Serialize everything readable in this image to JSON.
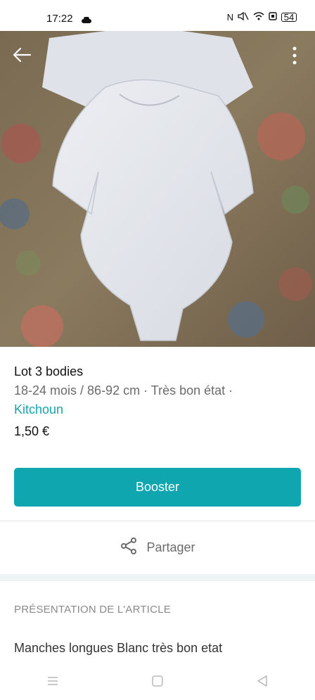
{
  "status_bar": {
    "time": "17:22",
    "battery": "54",
    "icons": [
      "cloud-icon",
      "nfc-icon",
      "mute-icon",
      "wifi-icon",
      "sim-icon",
      "battery-icon"
    ]
  },
  "item": {
    "title": "Lot 3 bodies",
    "meta": "18-24 mois / 86-92 cm · Très bon état ·",
    "brand": "Kitchoun",
    "price": "1,50 €"
  },
  "actions": {
    "booster_label": "Booster",
    "share_label": "Partager"
  },
  "section": {
    "header": "PRÉSENTATION DE L'ARTICLE",
    "description": "Manches longues Blanc très bon etat"
  },
  "colors": {
    "accent": "#0fa6b0",
    "brand_link": "#1aa3ad",
    "muted_text": "#6b6b6b"
  }
}
